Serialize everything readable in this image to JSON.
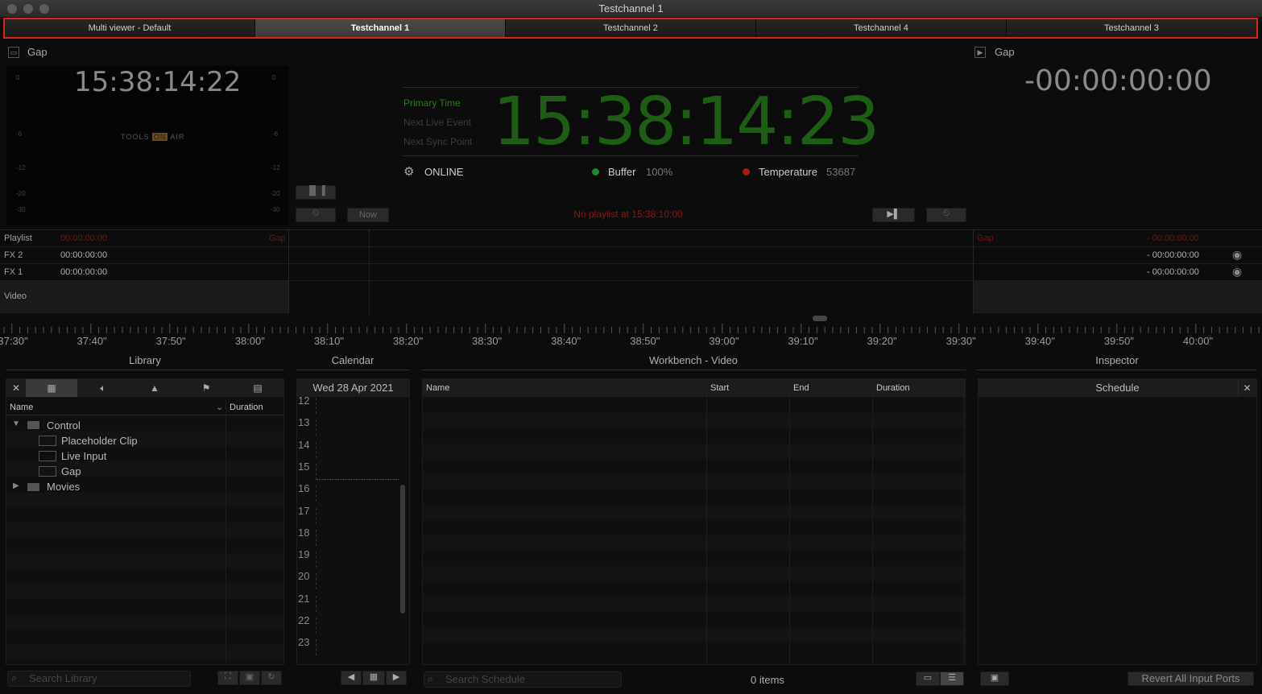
{
  "window": {
    "title": "Testchannel 1"
  },
  "tabs": [
    {
      "label": "Multi viewer - Default"
    },
    {
      "label": "Testchannel 1"
    },
    {
      "label": "Testchannel 2"
    },
    {
      "label": "Testchannel 4"
    },
    {
      "label": "Testchannel 3"
    }
  ],
  "left_panel": {
    "label": "Gap",
    "timecode": "15:38:14:22",
    "logo_left": "TOOLS",
    "logo_box": "ON",
    "logo_right": "AIR"
  },
  "right_panel": {
    "label": "Gap",
    "timecode": "-00:00:00:00"
  },
  "clock": {
    "primary_label": "Primary Time",
    "next_live_label": "Next Live Event",
    "next_sync_label": "Next Sync Point",
    "time": "15:38:14:23"
  },
  "status": {
    "online": "ONLINE",
    "buffer_label": "Buffer",
    "buffer_value": "100%",
    "temperature_label": "Temperature",
    "temperature_value": "53687",
    "colors": {
      "buffer": "#1f8a2a",
      "temperature": "#a01c14"
    }
  },
  "controls": {
    "now_label": "Now"
  },
  "no_playlist": "No playlist at 15:38:10:00",
  "tracks": [
    {
      "name": "Playlist",
      "tc": "00:00:00:00",
      "tag": "Gap",
      "right_tag": "Gap",
      "right_tc": "- 00:00:00:00"
    },
    {
      "name": "FX 2",
      "tc": "00:00:00:00",
      "right_tc": "- 00:00:00:00"
    },
    {
      "name": "FX 1",
      "tc": "00:00:00:00",
      "right_tc": "- 00:00:00:00"
    },
    {
      "name": "Video"
    }
  ],
  "ruler": [
    "37:30\"",
    "37:40\"",
    "37:50\"",
    "38:00\"",
    "38:10\"",
    "38:20\"",
    "38:30\"",
    "38:40\"",
    "38:50\"",
    "39:00\"",
    "39:10\"",
    "39:20\"",
    "39:30\"",
    "39:40\"",
    "39:50\"",
    "40:00\""
  ],
  "library": {
    "title": "Library",
    "col_name": "Name",
    "col_duration": "Duration",
    "items": [
      {
        "label": "Control"
      },
      {
        "label": "Placeholder Clip"
      },
      {
        "label": "Live Input"
      },
      {
        "label": "Gap"
      },
      {
        "label": "Movies"
      }
    ],
    "search_placeholder": "Search Library"
  },
  "calendar": {
    "title": "Calendar",
    "date": "Wed 28 Apr 2021",
    "hours": [
      "12",
      "13",
      "14",
      "15",
      "16",
      "17",
      "18",
      "19",
      "20",
      "21",
      "22",
      "23"
    ]
  },
  "workbench": {
    "title": "Workbench - Video",
    "columns": [
      "Name",
      "Start",
      "End",
      "Duration"
    ],
    "search_placeholder": "Search Schedule",
    "items_count": "0 items"
  },
  "inspector": {
    "title": "Inspector",
    "schedule_label": "Schedule",
    "revert_label": "Revert All Input Ports"
  }
}
